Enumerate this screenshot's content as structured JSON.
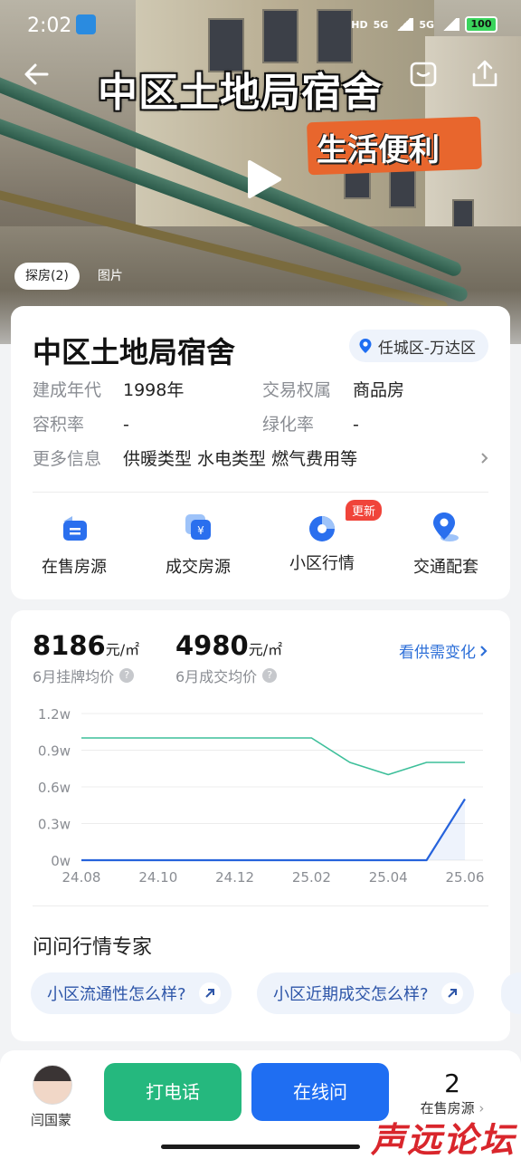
{
  "status_bar": {
    "time": "2:02",
    "signal_labels": [
      "HD",
      "5G",
      "5G"
    ],
    "battery": "100"
  },
  "hero": {
    "title": "中区土地局宿舍",
    "subtitle": "生活便利"
  },
  "media_tabs": [
    {
      "label": "探房(2)",
      "active": true
    },
    {
      "label": "图片",
      "active": false
    }
  ],
  "community": {
    "name": "中区土地局宿舍",
    "location": "任城区-万达区",
    "info": {
      "built_label": "建成年代",
      "built_value": "1998年",
      "right_label": "交易权属",
      "right_value": "商品房",
      "plot_label": "容积率",
      "plot_value": "-",
      "green_label": "绿化率",
      "green_value": "-",
      "more_label": "更多信息",
      "more_value": "供暖类型 水电类型 燃气费用等"
    },
    "quick_links": [
      {
        "label": "在售房源",
        "icon": "listing-icon"
      },
      {
        "label": "成交房源",
        "icon": "deal-icon"
      },
      {
        "label": "小区行情",
        "icon": "market-icon",
        "badge": "更新"
      },
      {
        "label": "交通配套",
        "icon": "transit-icon"
      }
    ]
  },
  "prices": {
    "listing": {
      "value": "8186",
      "unit": "元/㎡",
      "caption": "6月挂牌均价"
    },
    "deal": {
      "value": "4980",
      "unit": "元/㎡",
      "caption": "6月成交均价"
    },
    "trend_link": "看供需变化"
  },
  "chart_data": {
    "type": "line",
    "x": [
      "24.08",
      "24.09",
      "24.10",
      "24.11",
      "24.12",
      "25.01",
      "25.02",
      "25.03",
      "25.04",
      "25.05",
      "25.06"
    ],
    "x_tick_labels": [
      "24.08",
      "24.10",
      "24.12",
      "25.02",
      "25.04",
      "25.06"
    ],
    "y_tick_labels": [
      "1.2w",
      "0.9w",
      "0.6w",
      "0.3w",
      "0w"
    ],
    "ylim": [
      0,
      12000
    ],
    "grid": true,
    "series": [
      {
        "values": [
          10000,
          10000,
          10000,
          10000,
          10000,
          10000,
          10000,
          8000,
          7000,
          8000,
          8000
        ],
        "color": "#3dbf9a"
      },
      {
        "values": [
          0,
          0,
          0,
          0,
          0,
          0,
          0,
          0,
          0,
          0,
          5000
        ],
        "color": "#2663dc"
      }
    ]
  },
  "expert": {
    "title": "问问行情专家",
    "chips": [
      "小区流通性怎么样?",
      "小区近期成交怎么样?"
    ]
  },
  "bottom_bar": {
    "agent_name": "闫国蒙",
    "call_label": "打电话",
    "ask_label": "在线问",
    "onsale_count": "2",
    "onsale_label": "在售房源"
  },
  "watermark": "声远论坛"
}
